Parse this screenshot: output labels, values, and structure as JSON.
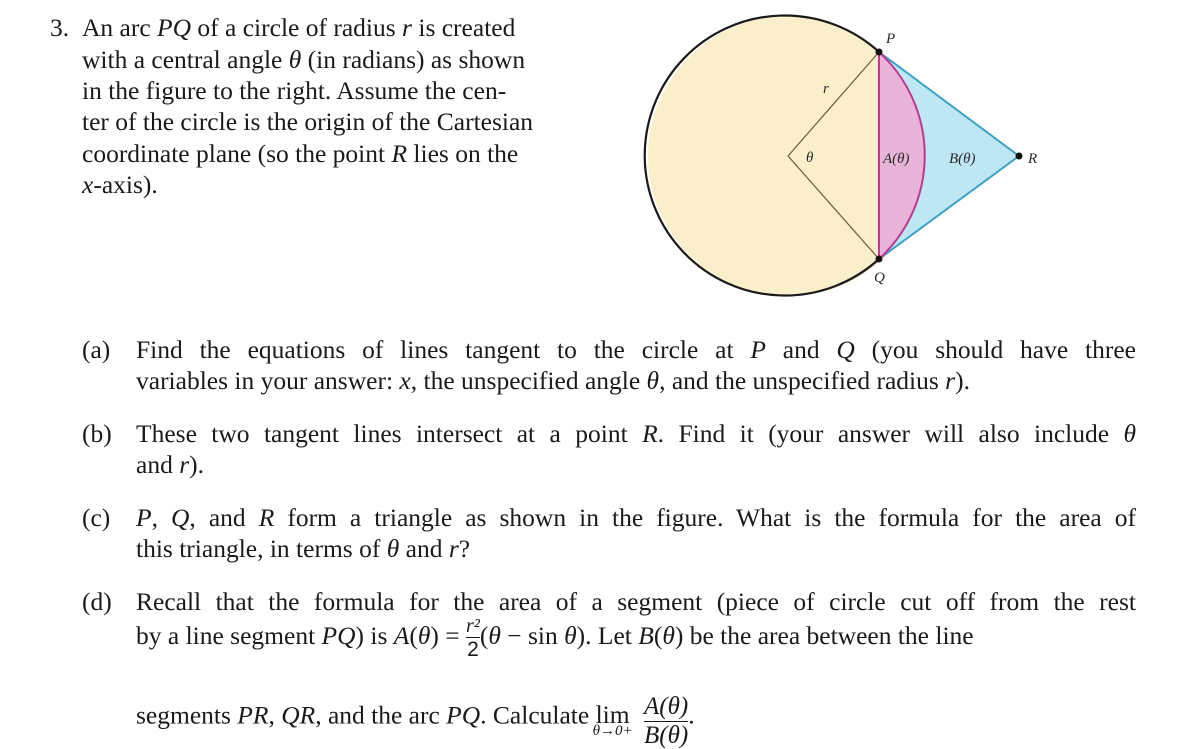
{
  "problem": {
    "number": "3.",
    "intro_lines": [
      [
        {
          "t": "An arc "
        },
        {
          "t": "PQ",
          "i": true
        },
        {
          "t": " of a circle of radius "
        },
        {
          "t": "r",
          "i": true
        },
        {
          "t": " is created"
        }
      ],
      [
        {
          "t": "with a central angle "
        },
        {
          "t": "θ",
          "i": true
        },
        {
          "t": " (in radians) as shown"
        }
      ],
      [
        {
          "t": "in the figure to the right.  Assume the cen-"
        }
      ],
      [
        {
          "t": "ter of the circle is the origin of the Cartesian"
        }
      ],
      [
        {
          "t": "coordinate plane (so the point "
        },
        {
          "t": "R",
          "i": true
        },
        {
          "t": " lies on the"
        }
      ],
      [
        {
          "t": "x",
          "i": true
        },
        {
          "t": "-axis)."
        }
      ]
    ],
    "figure": {
      "labels": {
        "P": "P",
        "Q": "Q",
        "R": "R",
        "radius": "r",
        "angle": "θ",
        "segment_area": "A(θ)",
        "outer_area": "B(θ)"
      },
      "colors": {
        "circle_fill": "#fbeecb",
        "circle_stroke": "#1a1a1a",
        "segment_fill": "#e8b4d8",
        "segment_stroke": "#c2378f",
        "triangle_fill": "#bfe6f3",
        "triangle_stroke": "#3aa4c8",
        "radius_line": "#6b5a3a"
      }
    },
    "parts": [
      {
        "label": "(a)",
        "lines": [
          [
            {
              "t": "Find the equations of lines tangent to the circle at "
            },
            {
              "t": "P",
              "i": true
            },
            {
              "t": " and "
            },
            {
              "t": "Q",
              "i": true
            },
            {
              "t": " (you should have three"
            }
          ],
          [
            {
              "t": "variables in your answer: "
            },
            {
              "t": "x",
              "i": true
            },
            {
              "t": ", the unspecified angle "
            },
            {
              "t": "θ",
              "i": true
            },
            {
              "t": ", and the unspecified radius "
            },
            {
              "t": "r",
              "i": true
            },
            {
              "t": ")."
            }
          ]
        ]
      },
      {
        "label": "(b)",
        "lines": [
          [
            {
              "t": "These two tangent lines intersect at a point "
            },
            {
              "t": "R",
              "i": true
            },
            {
              "t": ". Find it (your answer will also include "
            },
            {
              "t": "θ",
              "i": true
            }
          ],
          [
            {
              "t": "and "
            },
            {
              "t": "r",
              "i": true
            },
            {
              "t": ")."
            }
          ]
        ]
      },
      {
        "label": "(c)",
        "lines": [
          [
            {
              "t": "P",
              "i": true
            },
            {
              "t": ", "
            },
            {
              "t": "Q",
              "i": true
            },
            {
              "t": ", and "
            },
            {
              "t": "R",
              "i": true
            },
            {
              "t": " form a triangle as shown in the figure. What is the formula for the area of"
            }
          ],
          [
            {
              "t": "this triangle, in terms of "
            },
            {
              "t": "θ",
              "i": true
            },
            {
              "t": " and "
            },
            {
              "t": "r",
              "i": true
            },
            {
              "t": "?"
            }
          ]
        ]
      },
      {
        "label": "(d)",
        "line1": [
          {
            "t": "Recall that the formula for the area of a segment (piece of circle cut off from the rest"
          }
        ],
        "line2_before": [
          {
            "t": "by a line segment "
          },
          {
            "t": "PQ",
            "i": true
          },
          {
            "t": ") is "
          },
          {
            "t": "A",
            "i": true
          },
          {
            "t": "("
          },
          {
            "t": "θ",
            "i": true
          },
          {
            "t": ") = "
          }
        ],
        "formula_num": "r²",
        "formula_den": "2",
        "line2_after": [
          {
            "t": "("
          },
          {
            "t": "θ",
            "i": true
          },
          {
            "t": " − sin "
          },
          {
            "t": "θ",
            "i": true
          },
          {
            "t": "). Let "
          },
          {
            "t": "B",
            "i": true
          },
          {
            "t": "("
          },
          {
            "t": "θ",
            "i": true
          },
          {
            "t": ") be the area between the line"
          }
        ],
        "line3_before": [
          {
            "t": "segments "
          },
          {
            "t": "PR",
            "i": true
          },
          {
            "t": ", "
          },
          {
            "t": "QR",
            "i": true
          },
          {
            "t": ", and the arc "
          },
          {
            "t": "PQ",
            "i": true
          },
          {
            "t": ". Calculate "
          }
        ],
        "lim_word": "lim",
        "lim_sub": "θ→0+",
        "limit_num": "A(θ)",
        "limit_den": "B(θ)",
        "line3_after": "."
      }
    ]
  }
}
